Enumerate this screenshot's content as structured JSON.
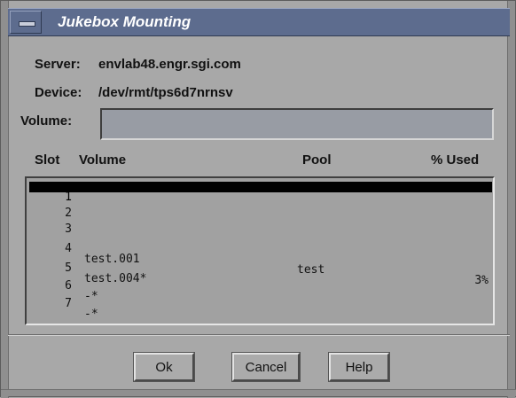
{
  "window": {
    "title": "Jukebox Mounting"
  },
  "titlebar": {
    "menu_icon": "window-menu-icon"
  },
  "info": {
    "server_label": "Server:",
    "server_value": "envlab48.engr.sgi.com",
    "device_label": "Device:",
    "device_value": "/dev/rmt/tps6d7nrnsv",
    "volume_label": "Volume:",
    "volume_value": "",
    "volume_placeholder": ""
  },
  "table": {
    "columns": {
      "slot": "Slot",
      "volume": "Volume",
      "pool": "Pool",
      "used": "% Used"
    },
    "rows": [
      {
        "slot": "1",
        "volume": "",
        "pool": "",
        "used": ""
      },
      {
        "slot": "2",
        "volume": "",
        "pool": "",
        "used": ""
      },
      {
        "slot": "3",
        "volume": "",
        "pool": "",
        "used": ""
      },
      {
        "slot": "4",
        "volume": "test.001",
        "pool": "test",
        "used": "3%"
      },
      {
        "slot": "5",
        "volume": "test.004*",
        "pool": "",
        "used": ""
      },
      {
        "slot": "6",
        "volume": "-*",
        "pool": "",
        "used": ""
      },
      {
        "slot": "7",
        "volume": "-*",
        "pool": "",
        "used": ""
      }
    ],
    "selected_row": 1
  },
  "buttons": {
    "ok": "Ok",
    "cancel": "Cancel",
    "help": "Help"
  },
  "colors": {
    "titlebar": "#5d6c8e",
    "background": "#a8a8a8",
    "selection": "#000000"
  }
}
